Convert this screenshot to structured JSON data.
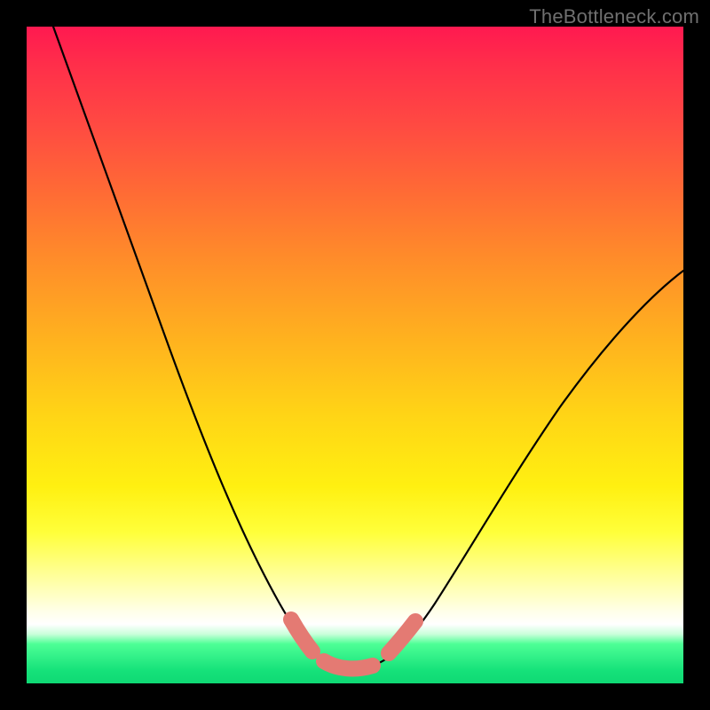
{
  "watermark": "TheBottleneck.com",
  "colors": {
    "background_frame": "#000000",
    "curve_stroke": "#000000",
    "accent_segment": "#e47a73",
    "gradient_stops": [
      "#ff1950",
      "#ff2f4a",
      "#ff4a42",
      "#ff6a35",
      "#ff8b2a",
      "#ffb01f",
      "#ffd416",
      "#fff011",
      "#ffff3a",
      "#ffffae",
      "#ffffe8",
      "#ffffff",
      "#caffda",
      "#4dff96",
      "#16e27a",
      "#0fd974"
    ]
  },
  "chart_data": {
    "type": "line",
    "title": "",
    "xlabel": "",
    "ylabel": "",
    "x_range": [
      0,
      100
    ],
    "y_range": [
      0,
      100
    ],
    "series": [
      {
        "name": "bottleneck-curve",
        "x": [
          4,
          10,
          15,
          20,
          25,
          30,
          35,
          38,
          41,
          43,
          45,
          48,
          52,
          55,
          60,
          65,
          70,
          75,
          80,
          85,
          90,
          95,
          99
        ],
        "y": [
          100,
          85,
          72,
          59,
          47,
          35,
          24,
          16,
          10,
          6,
          4,
          3,
          3,
          4,
          7,
          12,
          19,
          27,
          35,
          43,
          51,
          58,
          62
        ]
      },
      {
        "name": "highlighted-minimum-segment",
        "x": [
          41,
          43,
          45,
          48,
          52,
          55,
          58
        ],
        "y": [
          10,
          6,
          4,
          3,
          3,
          4,
          7
        ]
      }
    ],
    "annotations": []
  }
}
